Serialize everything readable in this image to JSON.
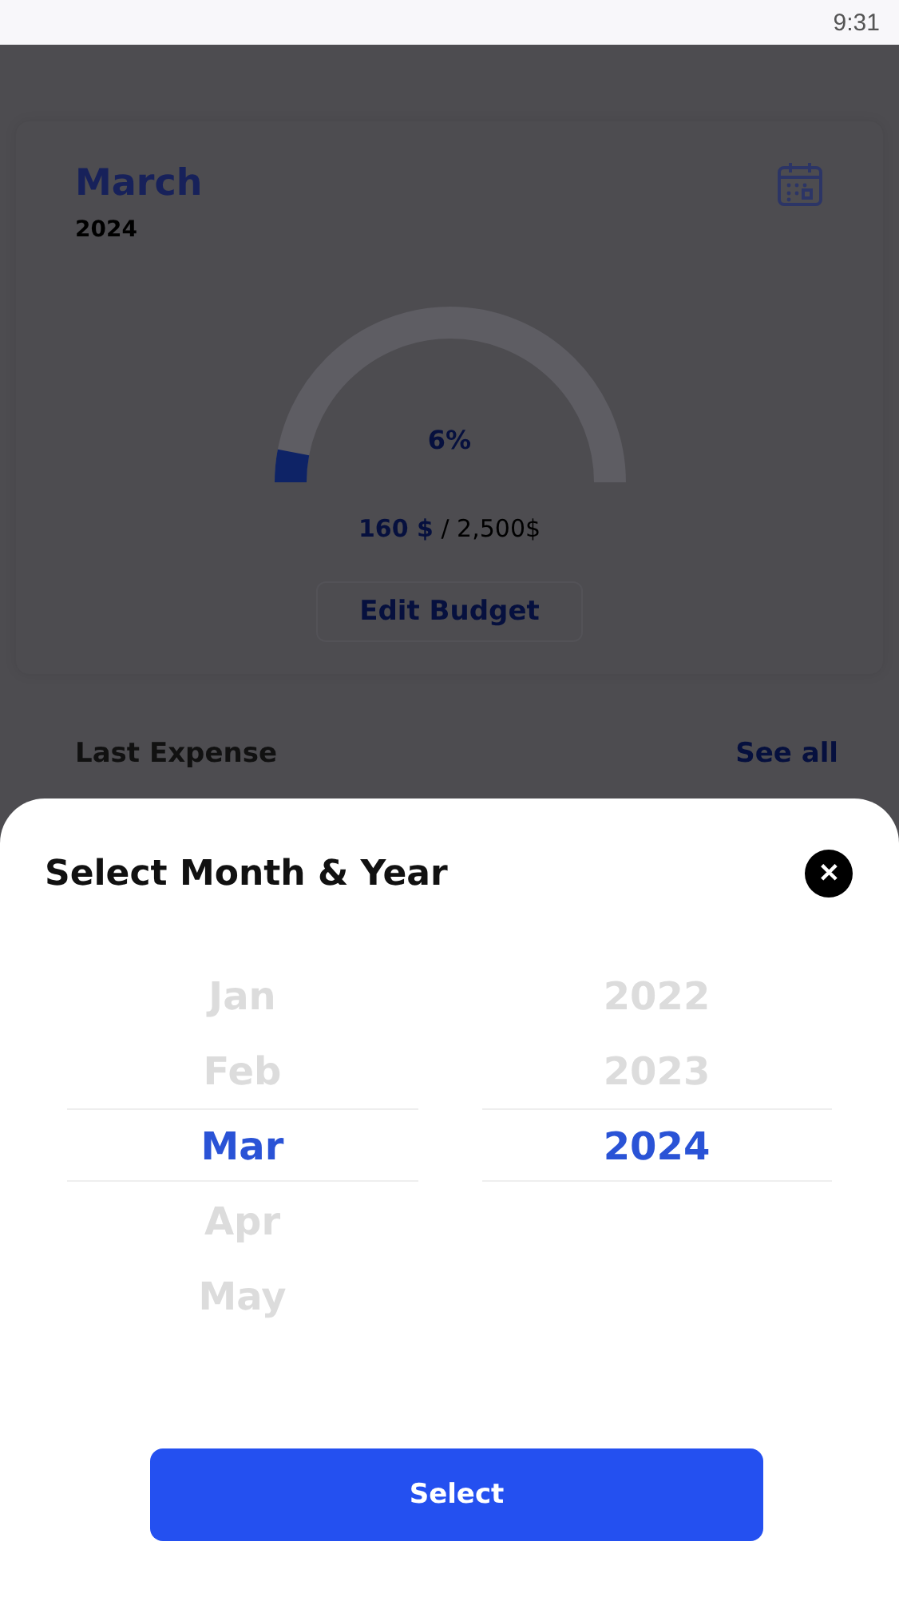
{
  "status_bar": {
    "time": "9:31"
  },
  "budget_card": {
    "month": "March",
    "year": "2024",
    "gauge": {
      "level": 0.06,
      "percent": "6%"
    },
    "spent": "160 $",
    "total": " / 2,500$",
    "edit_button": "Edit Budget"
  },
  "last_expense": {
    "title": "Last Expense",
    "link": "See all"
  },
  "sheet": {
    "title": "Select Month & Year",
    "close": "✕",
    "months": [
      {
        "label": "Jan",
        "selected": false
      },
      {
        "label": "Feb",
        "selected": false
      },
      {
        "label": "Mar",
        "selected": true
      },
      {
        "label": "Apr",
        "selected": false
      },
      {
        "label": "May",
        "selected": false
      }
    ],
    "years": [
      {
        "label": "2022",
        "selected": false
      },
      {
        "label": "2023",
        "selected": false
      },
      {
        "label": "2024",
        "selected": true
      }
    ],
    "button": "Select"
  }
}
